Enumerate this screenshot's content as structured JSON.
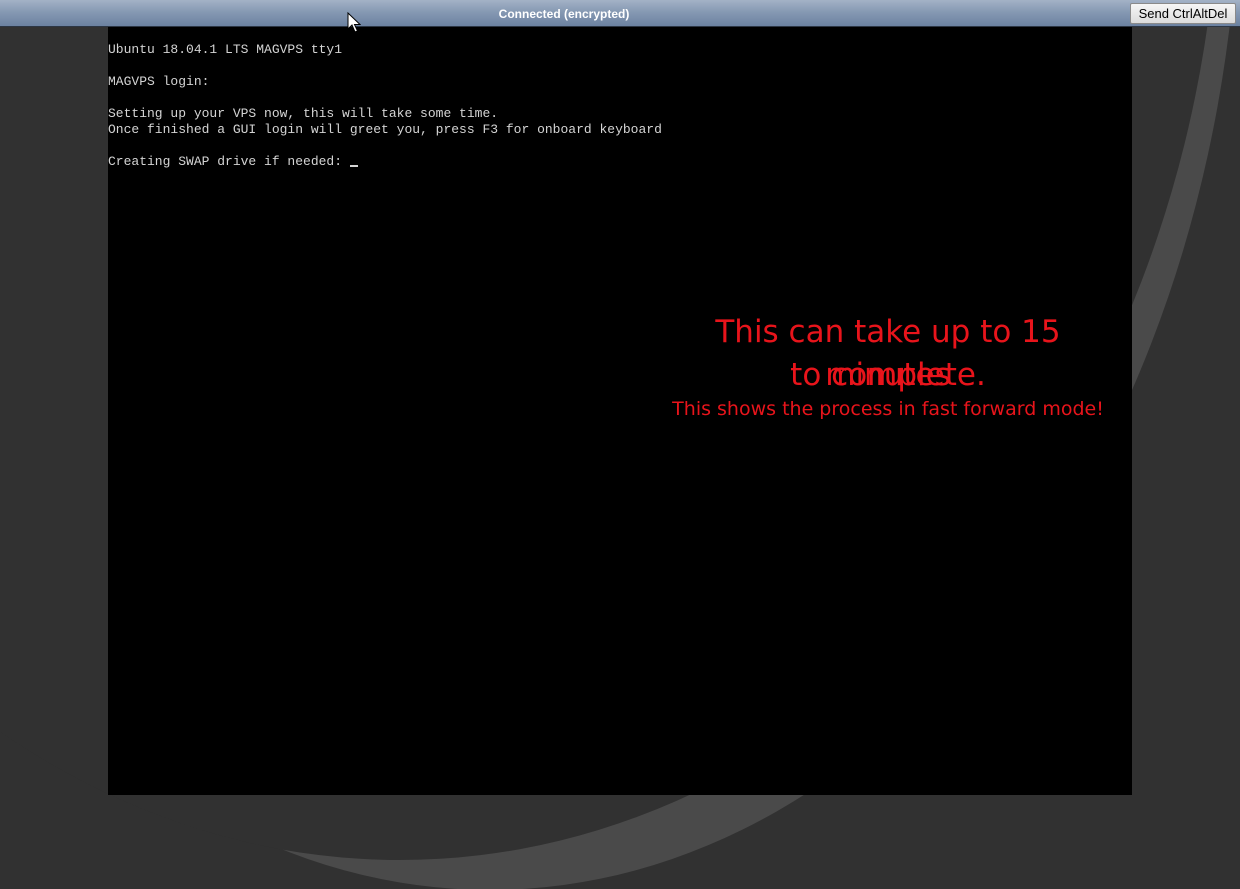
{
  "status_bar": {
    "text": "Connected (encrypted)",
    "ctrl_alt_del_label": "Send CtrlAltDel"
  },
  "terminal": {
    "lines": [
      "Ubuntu 18.04.1 LTS MAGVPS tty1",
      "MAGVPS login:",
      "Setting up your VPS now, this will take some time.",
      "Once finished a GUI login will greet you, press F3 for onboard keyboard",
      "Creating SWAP drive if needed:"
    ]
  },
  "overlay": {
    "line1": "This can take up to 15 minutes",
    "line2": "to complete.",
    "line3": "This shows the process in fast forward mode!"
  },
  "colors": {
    "overlay_text": "#e8141b",
    "terminal_text": "#d4d4d4",
    "status_text": "#ffffff"
  },
  "icons": {
    "pointer": "mouse-pointer-icon"
  }
}
